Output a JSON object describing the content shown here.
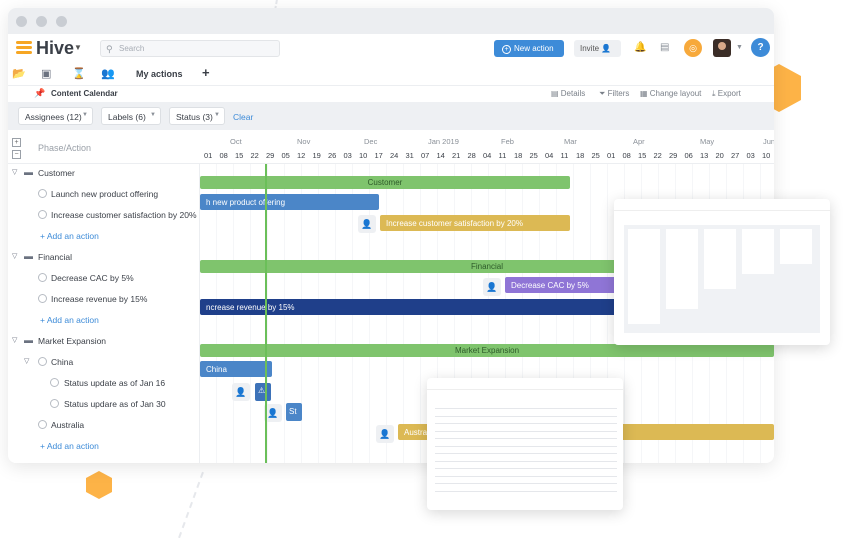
{
  "app": {
    "brand": "Hive"
  },
  "topbar": {
    "search_placeholder": "Search",
    "new_action": "New action",
    "invite": "Invite",
    "help": "?"
  },
  "nav": {
    "my_actions": "My actions",
    "plus": "+"
  },
  "subbar": {
    "title": "Content Calendar",
    "details": "Details",
    "filters": "Filters",
    "change_layout": "Change layout",
    "export": "Export"
  },
  "filters": {
    "assignees": "Assignees (12)",
    "labels": "Labels (6)",
    "status": "Status (3)",
    "clear": "Clear"
  },
  "left": {
    "header": "Phase/Action",
    "rows": [
      {
        "type": "group",
        "label": "Customer"
      },
      {
        "type": "action",
        "label": "Launch new product offering"
      },
      {
        "type": "action",
        "label": "Increase customer satisfaction by 20%"
      },
      {
        "type": "add",
        "label": "+ Add an action"
      },
      {
        "type": "group",
        "label": "Financial"
      },
      {
        "type": "action",
        "label": "Decrease CAC by 5%"
      },
      {
        "type": "action",
        "label": "Increase revenue by 15%"
      },
      {
        "type": "add",
        "label": "+ Add an action"
      },
      {
        "type": "group",
        "label": "Market Expansion"
      },
      {
        "type": "sub",
        "label": "China"
      },
      {
        "type": "subaction",
        "label": "Status update as of Jan 16"
      },
      {
        "type": "subaction",
        "label": "Status updare as of Jan 30"
      },
      {
        "type": "action",
        "label": "Australia"
      },
      {
        "type": "add",
        "label": "+ Add an action"
      }
    ]
  },
  "timeline": {
    "months": [
      "Oct",
      "Nov",
      "Dec",
      "Jan 2019",
      "Feb",
      "Mar",
      "Apr",
      "May",
      "Jun"
    ],
    "days": [
      "01",
      "08",
      "15",
      "22",
      "29",
      "05",
      "12",
      "19",
      "26",
      "03",
      "10",
      "17",
      "24",
      "31",
      "07",
      "14",
      "21",
      "28",
      "04",
      "11",
      "18",
      "25",
      "04",
      "11",
      "18",
      "25",
      "01",
      "08",
      "15",
      "22",
      "29",
      "06",
      "13",
      "20",
      "27",
      "03",
      "10"
    ]
  },
  "bars": {
    "customer": "Customer",
    "launch": "h new product offering",
    "satisfaction": "Increase customer satisfaction by 20%",
    "financial": "Financial",
    "cac": "Decrease CAC by 5%",
    "revenue": "ncrease revenue by 15%",
    "market": "Market Expansion",
    "china": "China",
    "status_short": "St",
    "australia": "Australi"
  },
  "colors": {
    "phase_green": "#7fc46d",
    "blue": "#4b86c8",
    "gold": "#dcb954",
    "purple": "#8f75d6",
    "navy": "#1f3f8a",
    "accent": "#3d8bd8",
    "orange": "#fdb347"
  }
}
